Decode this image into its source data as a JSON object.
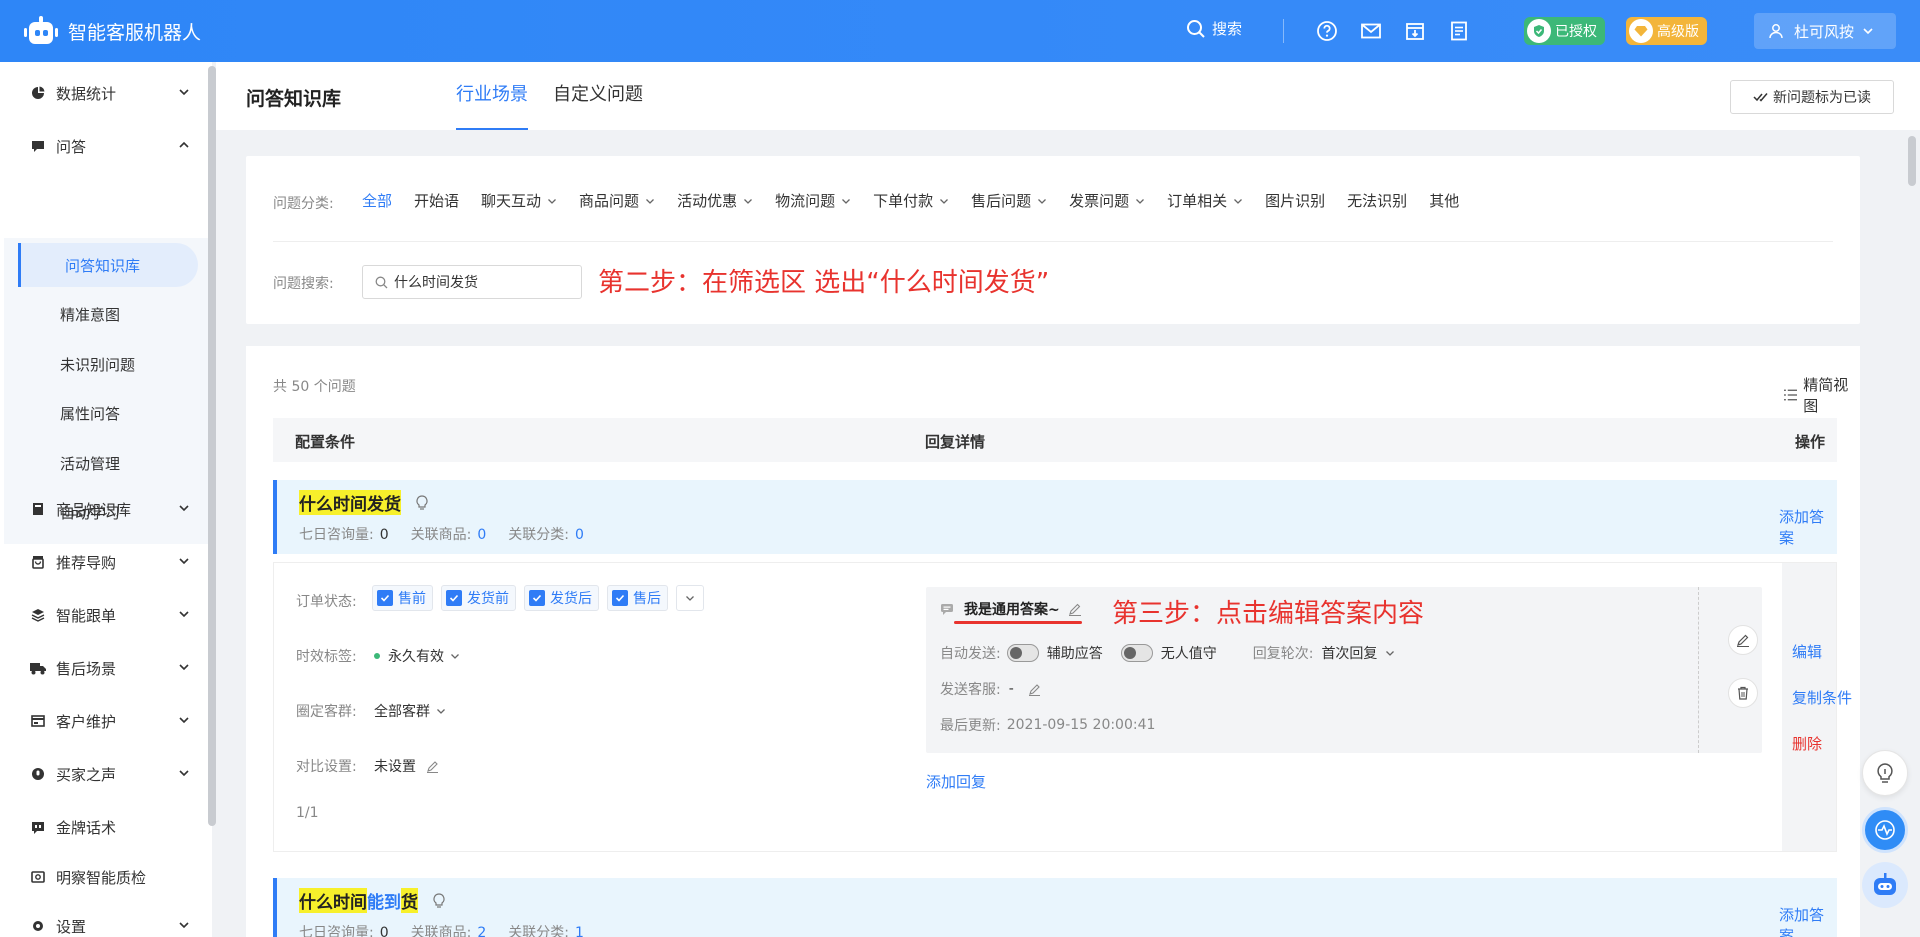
{
  "app": {
    "title": "智能客服机器人"
  },
  "topbar": {
    "search_label": "搜索",
    "authorized_label": "已授权",
    "pro_label": "高级版",
    "user_name": "杜可风按"
  },
  "sidebar": {
    "items": [
      {
        "label": "数据统计",
        "icon": "pie-chart-icon"
      },
      {
        "label": "问答",
        "icon": "chat-icon"
      },
      {
        "label": "商品知识库",
        "icon": "book-icon"
      },
      {
        "label": "推荐导购",
        "icon": "bag-icon"
      },
      {
        "label": "智能跟单",
        "icon": "layers-icon"
      },
      {
        "label": "售后场景",
        "icon": "truck-icon"
      },
      {
        "label": "客户维护",
        "icon": "card-icon"
      },
      {
        "label": "买家之声",
        "icon": "voice-icon"
      },
      {
        "label": "金牌话术",
        "icon": "quote-icon"
      },
      {
        "label": "明察智能质检",
        "icon": "inspect-icon"
      },
      {
        "label": "设置",
        "icon": "gear-icon"
      }
    ],
    "sub_items": [
      "问答知识库",
      "精准意图",
      "未识别问题",
      "属性问答",
      "活动管理",
      "自动学习"
    ]
  },
  "page_header": {
    "title": "问答知识库",
    "tabs": [
      "行业场景",
      "自定义问题"
    ],
    "mark_read_label": "新问题标为已读"
  },
  "filter": {
    "category_label": "问题分类:",
    "categories": [
      "全部",
      "开始语",
      "聊天互动",
      "商品问题",
      "活动优惠",
      "物流问题",
      "下单付款",
      "售后问题",
      "发票问题",
      "订单相关",
      "图片识别",
      "无法识别",
      "其他"
    ],
    "search_label": "问题搜索:",
    "search_value": "什么时间发货",
    "annotation_step2": "第二步：在筛选区  选出“什么时间发货”"
  },
  "list": {
    "total": "共 50 个问题",
    "view_label": "精简视图",
    "headers": {
      "conditions": "配置条件",
      "reply": "回复详情",
      "ops": "操作"
    },
    "questions": [
      {
        "title_hl1": "什么时间发货",
        "title_mid": "",
        "title_hl2": "",
        "meta": {
          "consult_label": "七日咨询量:",
          "consult": "0",
          "products_label": "关联商品:",
          "products": "0",
          "categories_label": "关联分类:",
          "categories": "0"
        },
        "add_answer": "添加答案"
      },
      {
        "title_hl1": "什么时间",
        "title_mid": "能到",
        "title_hl2": "货",
        "meta": {
          "consult_label": "七日咨询量:",
          "consult": "0",
          "products_label": "关联商品:",
          "products": "2",
          "categories_label": "关联分类:",
          "categories": "1"
        },
        "add_answer": "添加答案"
      }
    ],
    "detail": {
      "order_status_label": "订单状态:",
      "order_status": [
        "售前",
        "发货前",
        "发货后",
        "售后"
      ],
      "timeliness_label": "时效标签:",
      "timeliness_value": "永久有效",
      "group_label": "圈定客群:",
      "group_value": "全部客群",
      "compare_label": "对比设置:",
      "compare_value": "未设置",
      "pager": "1/1",
      "answer_title": "我是通用答案~",
      "annotation_step3": "第三步：点击编辑答案内容",
      "auto_send_label": "自动发送:",
      "assist_label": "辅助应答",
      "unattended_label": "无人值守",
      "rounds_label": "回复轮次:",
      "rounds_value": "首次回复",
      "agent_label": "发送客服:",
      "agent_value": "-",
      "updated_label": "最后更新:",
      "updated_value": "2021-09-15 20:00:41",
      "add_reply": "添加回复",
      "ops": {
        "edit": "编辑",
        "copy": "复制条件",
        "delete": "删除"
      }
    }
  },
  "colors": {
    "primary": "#2f7cf6",
    "annotation": "#e8332e",
    "highlight": "#f7f02b",
    "authorized": "#3cb878",
    "pro": "#f3b53a"
  }
}
